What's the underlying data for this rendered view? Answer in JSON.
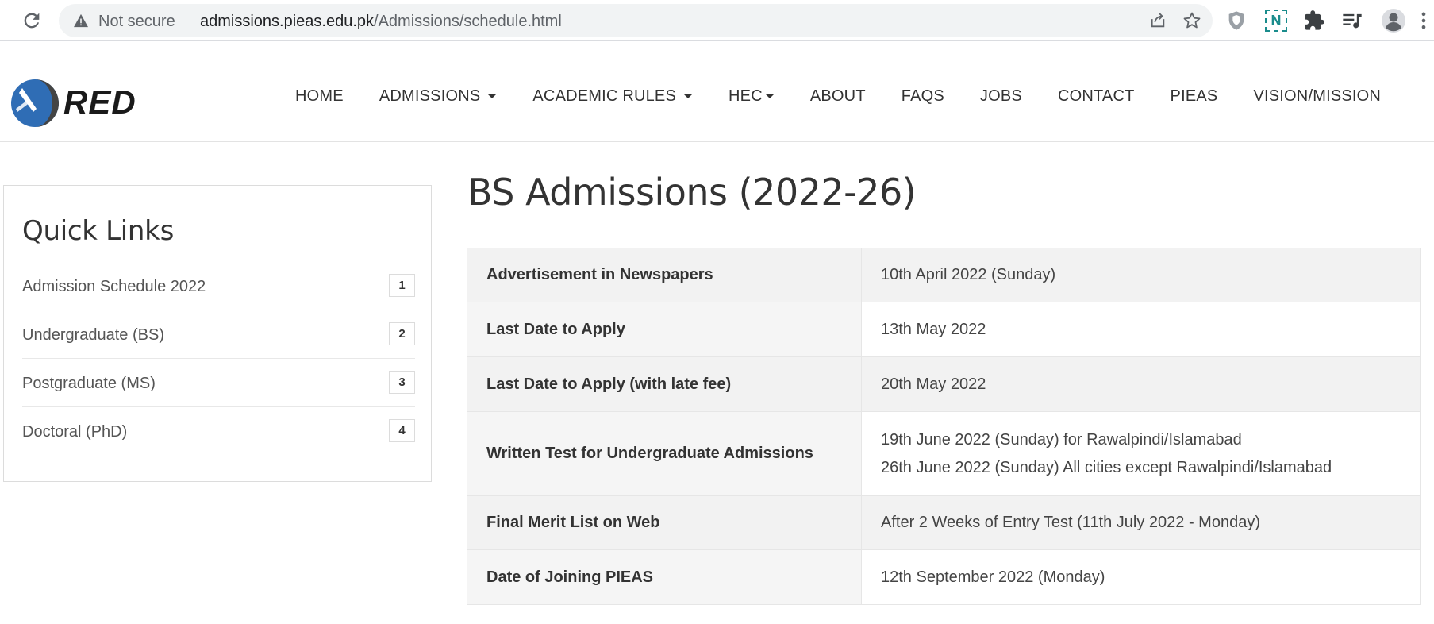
{
  "browser": {
    "security_label": "Not secure",
    "url_host": "admissions.pieas.edu.pk",
    "url_path": "/Admissions/schedule.html",
    "extension_letter": "N"
  },
  "site": {
    "logo_text": "RED",
    "nav": [
      {
        "label": "HOME",
        "has_dropdown": false
      },
      {
        "label": "ADMISSIONS",
        "has_dropdown": true
      },
      {
        "label": "ACADEMIC RULES",
        "has_dropdown": true
      },
      {
        "label": "HEC",
        "has_dropdown": true
      },
      {
        "label": "ABOUT",
        "has_dropdown": false
      },
      {
        "label": "FAQS",
        "has_dropdown": false
      },
      {
        "label": "JOBS",
        "has_dropdown": false
      },
      {
        "label": "CONTACT",
        "has_dropdown": false
      },
      {
        "label": "PIEAS",
        "has_dropdown": false
      },
      {
        "label": "VISION/MISSION",
        "has_dropdown": false
      }
    ]
  },
  "sidebar": {
    "title": "Quick Links",
    "items": [
      {
        "label": "Admission Schedule 2022",
        "badge": "1"
      },
      {
        "label": "Undergraduate (BS)",
        "badge": "2"
      },
      {
        "label": "Postgraduate (MS)",
        "badge": "3"
      },
      {
        "label": "Doctoral (PhD)",
        "badge": "4"
      }
    ]
  },
  "main": {
    "title": "BS Admissions (2022-26)",
    "schedule": [
      {
        "event": "Advertisement in Newspapers",
        "dates": [
          "10th April 2022 (Sunday)"
        ]
      },
      {
        "event": "Last Date to Apply",
        "dates": [
          "13th May 2022"
        ]
      },
      {
        "event": "Last Date to Apply (with late fee)",
        "dates": [
          "20th May 2022"
        ]
      },
      {
        "event": "Written Test for Undergraduate Admissions",
        "dates": [
          "19th June 2022 (Sunday) for Rawalpindi/Islamabad",
          "26th June 2022 (Sunday) All cities except Rawalpindi/Islamabad"
        ]
      },
      {
        "event": "Final Merit List on Web",
        "dates": [
          "After 2 Weeks of Entry Test (11th July 2022 - Monday)"
        ]
      },
      {
        "event": "Date of Joining PIEAS",
        "dates": [
          "12th September 2022 (Monday)"
        ]
      }
    ]
  },
  "colors": {
    "chrome_bg": "#ffffff",
    "omnibox_bg": "#f1f3f4",
    "text_dark": "#333333",
    "logo_blue": "#2f6db5",
    "extension_teal": "#1a8c8c"
  }
}
